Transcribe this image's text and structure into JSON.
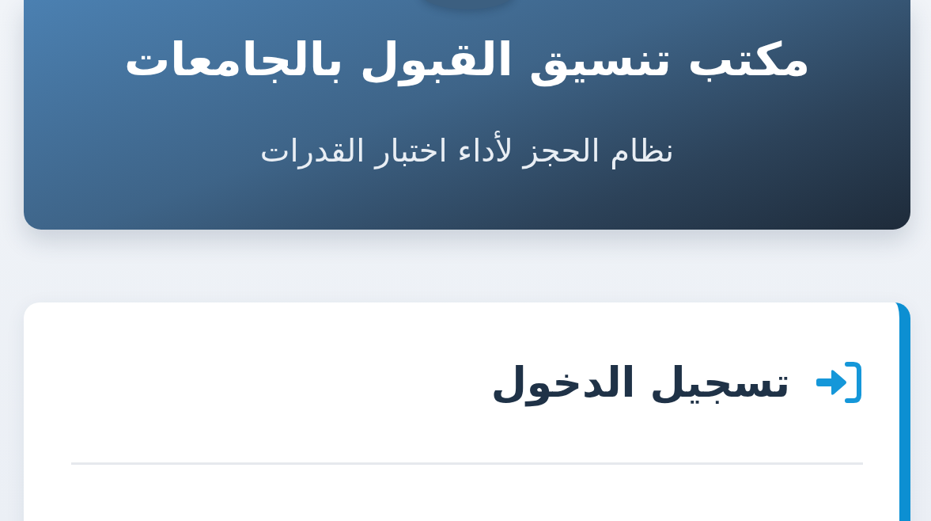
{
  "header": {
    "title": "مكتب تنسيق القبول بالجامعات",
    "subtitle": "نظام الحجز لأداء اختبار القدرات"
  },
  "login_card": {
    "heading": "تسجيل الدخول"
  }
}
